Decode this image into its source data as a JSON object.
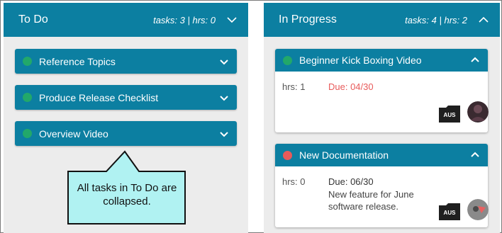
{
  "columns": [
    {
      "title": "To Do",
      "stats": "tasks: 3 | hrs: 0",
      "state": "collapsed",
      "tasks": [
        {
          "title": "Reference Topics",
          "status_color": "#22a86a"
        },
        {
          "title": "Produce Release Checklist",
          "status_color": "#22a86a"
        },
        {
          "title": "Overview Video",
          "status_color": "#22a86a"
        }
      ]
    },
    {
      "title": "In Progress",
      "stats": "tasks: 4 | hrs: 2",
      "state": "expanded",
      "tasks": [
        {
          "title": "Beginner Kick Boxing Video",
          "status_color": "#22a86a",
          "hrs": "hrs: 1",
          "due": "Due: 04/30",
          "due_overdue": true,
          "description": "",
          "folder_label": "AUS"
        },
        {
          "title": "New Documentation",
          "status_color": "#e85a5a",
          "hrs": "hrs: 0",
          "due": "Due: 06/30",
          "due_overdue": false,
          "description": "New feature for June software release.",
          "folder_label": "AUS"
        }
      ]
    }
  ],
  "callout": {
    "text": "All tasks in To Do are collapsed."
  },
  "colors": {
    "header": "#0c7fa1",
    "column_bg": "#ececec",
    "status_ok": "#22a86a",
    "status_alert": "#e85a5a",
    "callout_bg": "#b0f2f2"
  }
}
